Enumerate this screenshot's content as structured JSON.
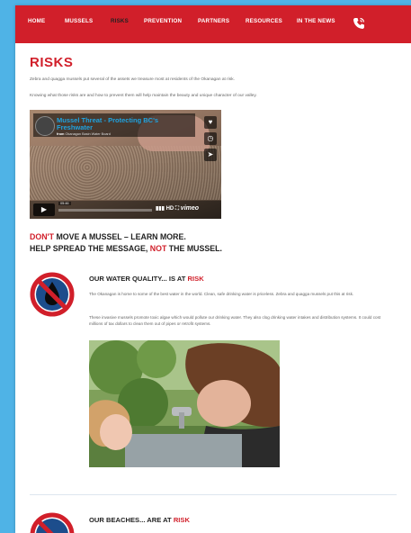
{
  "nav": {
    "items": [
      "HOME",
      "MUSSELS",
      "RISKS",
      "PREVENTION",
      "PARTNERS",
      "RESOURCES",
      "IN THE NEWS"
    ],
    "active": "RISKS"
  },
  "page": {
    "title": "RISKS",
    "intro1": "Zebra and quagga mussels put several of the assets we treasure most at residents of the Okanagan at risk.",
    "intro2": "Knowing what those risks are and how to prevent them will help maintain the beauty and unique character of our valley."
  },
  "video": {
    "title_line1": "Mussel Threat - Protecting BC's",
    "title_line2": "Freshwater",
    "from_label": "from",
    "from_channel": "Okanagan Basin Water Board",
    "time": "05:46",
    "hd": "HD",
    "brand": "vimeo",
    "like_icon": "heart-icon",
    "later_icon": "clock-icon",
    "share_icon": "send-icon",
    "play_icon": "play-icon"
  },
  "tagline": {
    "line1_red": "DON'T",
    "line1_rest": " MOVE A MUSSEL – LEARN MORE.",
    "line2_a": "HELP SPREAD THE MESSAGE, ",
    "line2_red": "NOT",
    "line2_b": " THE MUSSEL."
  },
  "sections": [
    {
      "title_a": "OUR WATER QUALITY... IS AT ",
      "title_red": "RISK",
      "p1": "The Okanagan is home to some of the best water in the world. Clean, safe drinking water is priceless. Zebra and quagga mussels put this at risk.",
      "p2": "These invasive mussels promote toxic algae which would pollute our drinking water. They also clog drinking water intakes and distribution systems. It could cost millions of tax dollars to clean them out of pipes or retrofit systems."
    },
    {
      "title_a": "OUR BEACHES... ARE AT ",
      "title_red": "RISK"
    }
  ],
  "colors": {
    "brand_red": "#d11f2a",
    "sign_blue": "#1c4d8c",
    "background_blue": "#4fb3e6"
  }
}
